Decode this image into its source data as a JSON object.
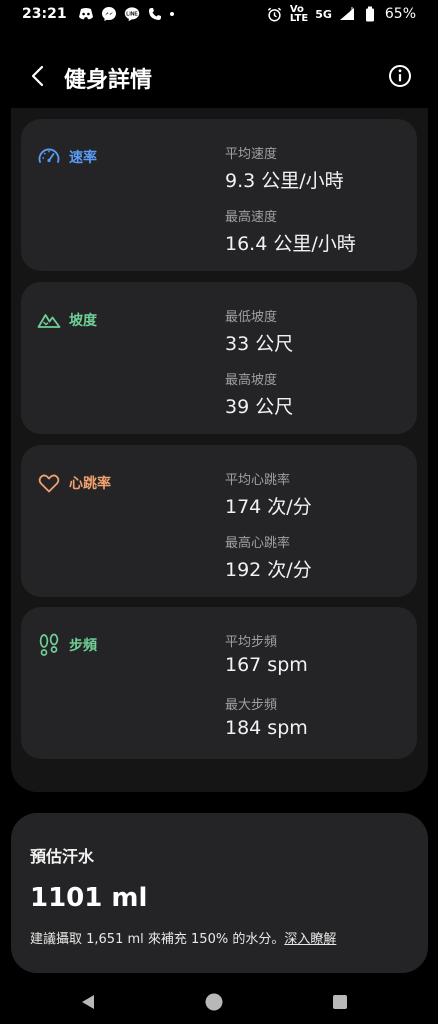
{
  "status_bar": {
    "time": "23:21",
    "net_top": "Vo",
    "net_bottom": "LTE",
    "network": "5G",
    "battery": "65%"
  },
  "header": {
    "title": "健身詳情"
  },
  "metrics": [
    {
      "name": "速率",
      "color": "#5b9bf5",
      "icon": "speedometer-icon",
      "stats": [
        {
          "label": "平均速度",
          "value": "9.3 公里/小時"
        },
        {
          "label": "最高速度",
          "value": "16.4 公里/小時"
        }
      ]
    },
    {
      "name": "坡度",
      "color": "#6fcf97",
      "icon": "mountain-icon",
      "stats": [
        {
          "label": "最低坡度",
          "value": "33 公尺"
        },
        {
          "label": "最高坡度",
          "value": "39 公尺"
        }
      ]
    },
    {
      "name": "心跳率",
      "color": "#f0a070",
      "icon": "heart-icon",
      "stats": [
        {
          "label": "平均心跳率",
          "value": "174 次/分"
        },
        {
          "label": "最高心跳率",
          "value": "192 次/分"
        }
      ]
    },
    {
      "name": "步頻",
      "color": "#6fcf97",
      "icon": "footsteps-icon",
      "stats": [
        {
          "label": "平均步頻",
          "value": "167 spm"
        },
        {
          "label": "最大步頻",
          "value": "184 spm"
        }
      ]
    }
  ],
  "sweat": {
    "title": "預估汗水",
    "value": "1101 ml",
    "note": "建議攝取 1,651 ml 來補充 150% 的水分。",
    "link": "深入瞭解"
  }
}
